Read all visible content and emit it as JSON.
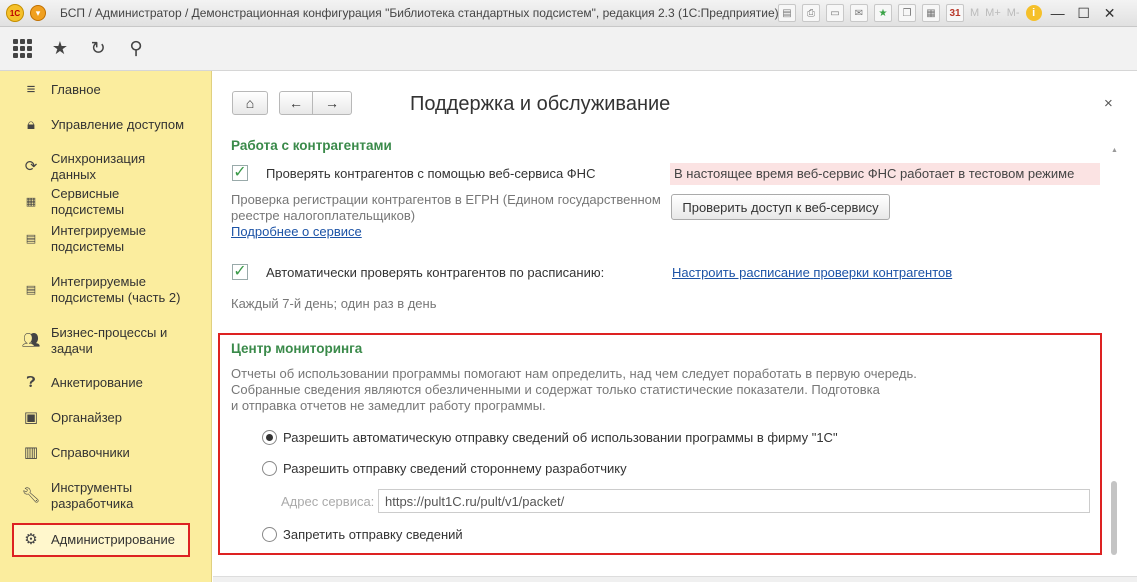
{
  "window": {
    "title": "БСП / Администратор / Демонстрационная конфигурация \"Библиотека стандартных подсистем\", редакция 2.3  (1С:Предприятие)",
    "logo_text": "1С",
    "menu_m": "M",
    "menu_mplus": "M+",
    "menu_mminus": "M-",
    "info_label": "i",
    "minimize": "—",
    "maximize": "☐",
    "close": "✕"
  },
  "sidebar": {
    "items": [
      {
        "label": "Главное",
        "icon": "menu-icon"
      },
      {
        "label": "Управление доступом",
        "icon": "lock-icon"
      },
      {
        "label": "Синхронизация данных",
        "icon": "sync-icon"
      },
      {
        "label": "Сервисные подсистемы",
        "icon": "grid-icon"
      },
      {
        "label": "Интегрируемые подсистемы",
        "icon": "bars-icon"
      },
      {
        "label": "Интегрируемые подсистемы (часть 2)",
        "icon": "bars-icon"
      },
      {
        "label": "Бизнес-процессы и задачи",
        "icon": "users-icon"
      },
      {
        "label": "Анкетирование",
        "icon": "question-icon"
      },
      {
        "label": "Органайзер",
        "icon": "organizer-icon"
      },
      {
        "label": "Справочники",
        "icon": "book-icon"
      },
      {
        "label": "Инструменты разработчика",
        "icon": "wrench-icon"
      },
      {
        "label": "Администрирование",
        "icon": "gear-icon"
      }
    ],
    "active_index": 11
  },
  "main": {
    "title": "Поддержка и обслуживание",
    "close": "×",
    "contractors": {
      "title": "Работа с контрагентами",
      "check_fns_label": "Проверять контрагентов с помощью веб-сервиса ФНС",
      "check_fns_checked": true,
      "fns_warning": "В настоящее время веб-сервис ФНС работает в тестовом режиме",
      "egrn_line1": "Проверка регистрации контрагентов в ЕГРН (Едином государственном",
      "egrn_line2": "реестре налогоплательщиков)",
      "more_link": "Подробнее о сервисе",
      "check_access_button": "Проверить доступ к веб-сервису",
      "auto_check_label": "Автоматически проверять контрагентов по расписанию:",
      "auto_check_checked": true,
      "schedule_link": "Настроить расписание проверки контрагентов",
      "schedule_text": "Каждый 7-й день; один раз в день"
    },
    "monitoring": {
      "title": "Центр мониторинга",
      "desc_line1": "Отчеты об использовании программы помогают нам определить, над чем следует поработать в первую очередь.",
      "desc_line2": "Собранные сведения являются обезличенными и содержат только статистические показатели. Подготовка",
      "desc_line3": "и отправка отчетов не замедлит работу программы.",
      "options": [
        "Разрешить автоматическую отправку сведений об использовании программы в фирму \"1С\"",
        "Разрешить отправку сведений стороннему разработчику",
        "Запретить отправку сведений"
      ],
      "selected_option": 0,
      "address_label": "Адрес сервиса:",
      "address_value": "https://pult1C.ru/pult/v1/packet/"
    }
  }
}
